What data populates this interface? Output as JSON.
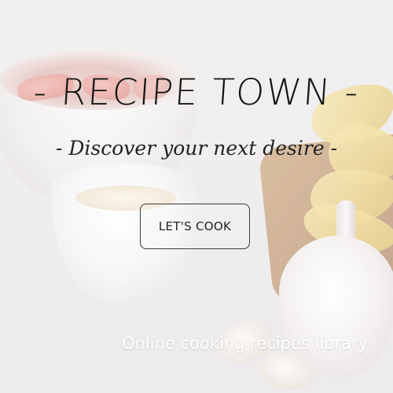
{
  "hero": {
    "title": "- RECIPE TOWN -",
    "subtitle": "- Discover your next desire -",
    "cta_label": "LET'S COOK",
    "tagline": "Online cooking recipes library"
  },
  "colors": {
    "text_dark": "#151515",
    "text_light": "#ffffff",
    "button_border": "#3b3b3b"
  }
}
